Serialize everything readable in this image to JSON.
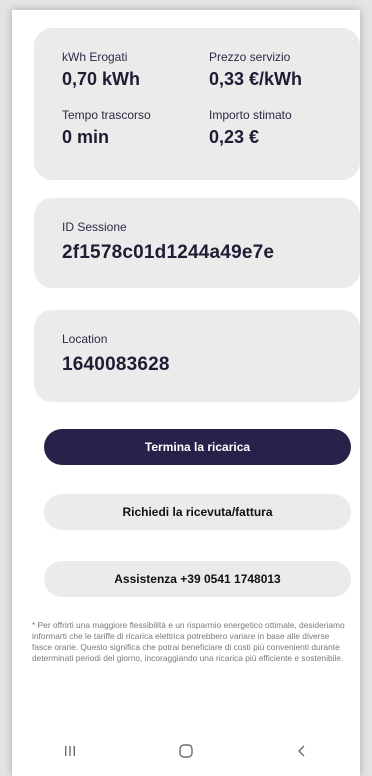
{
  "stats": {
    "kwh_label": "kWh Erogati",
    "kwh_value": "0,70 kWh",
    "price_label": "Prezzo servizio",
    "price_value": "0,33 €/kWh",
    "time_label": "Tempo trascorso",
    "time_value": "0 min",
    "amount_label": "Importo stimato",
    "amount_value": "0,23 €"
  },
  "session": {
    "label": "ID Sessione",
    "value": "2f1578c01d1244a49e7e"
  },
  "location": {
    "label": "Location",
    "value": "1640083628"
  },
  "buttons": {
    "stop": "Termina la ricarica",
    "receipt": "Richiedi la ricevuta/fattura",
    "support": "Assistenza +39 0541 1748013"
  },
  "note": "* Per offrirti una maggiore flessibilità e un risparmio energetico ottimale, desideriamo informarti che le tariffe di ricarica elettrica potrebbero variare in base alle diverse fasce orarie. Questo significa che potrai beneficiare di costi più convenienti durante determinati periodi del giorno, incoraggiando una ricarica più efficiente e sostenibile.",
  "nav": {
    "recents_icon": "recents-icon",
    "home_icon": "home-icon",
    "back_icon": "back-icon"
  },
  "colors": {
    "primary": "#27224a",
    "card": "#ebebeb",
    "text": "#1f1c33"
  }
}
